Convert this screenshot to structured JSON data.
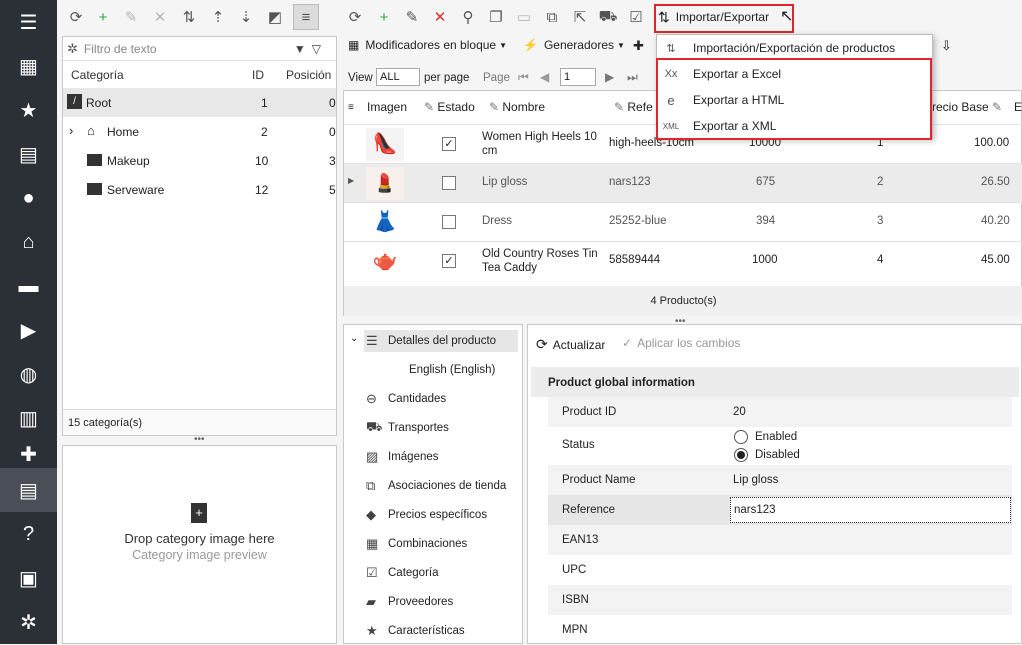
{
  "sidebar": {
    "icons": [
      "menu-icon",
      "store-icon",
      "star-icon",
      "inbox-icon",
      "user-icon",
      "basket-icon",
      "chat-icon",
      "truck-icon",
      "globe-icon",
      "chart-icon",
      "puzzle-icon",
      "box-icon",
      "help-icon",
      "lock-icon",
      "gear-icon"
    ]
  },
  "toolbar": {
    "import_export": "Importar/Exportar",
    "bulk_modifiers": "Modificadores en bloque",
    "generators": "Generadores"
  },
  "dropdown": {
    "items": [
      {
        "label": "Importación/Exportación de productos",
        "icon": "import-export-icon"
      },
      {
        "label": "Exportar a Excel",
        "icon": "excel-icon"
      },
      {
        "label": "Exportar a HTML",
        "icon": "html-icon"
      },
      {
        "label": "Exportar a XML",
        "icon": "xml-icon"
      }
    ]
  },
  "categories": {
    "filter_placeholder": "Filtro de texto",
    "headers": {
      "name": "Categoría",
      "id": "ID",
      "position": "Posición"
    },
    "rows": [
      {
        "name": "Root",
        "id": "1",
        "position": "0"
      },
      {
        "name": "Home",
        "id": "2",
        "position": "0"
      },
      {
        "name": "Makeup",
        "id": "10",
        "position": "3"
      },
      {
        "name": "Serveware",
        "id": "12",
        "position": "5"
      }
    ],
    "footer": "15 categoría(s)"
  },
  "image_drop": {
    "title": "Drop category image here",
    "subtitle": "Category image preview"
  },
  "paging": {
    "view_label": "View",
    "view_value": "ALL",
    "per_page": "per page",
    "page_label": "Page",
    "page_value": "1"
  },
  "grid": {
    "headers": {
      "image": "Imagen",
      "status": "Estado",
      "name": "Nombre",
      "reference": "Refe",
      "base_price": "recio Base"
    },
    "rows": [
      {
        "name": "Women High Heels 10 cm",
        "reference": "high-heels-10cm",
        "qty": "10000",
        "pos": "1",
        "price": "100.00",
        "checked": "✓"
      },
      {
        "name": "Lip gloss",
        "reference": "nars123",
        "qty": "675",
        "pos": "2",
        "price": "26.50",
        "checked": ""
      },
      {
        "name": "Dress",
        "reference": "25252-blue",
        "qty": "394",
        "pos": "3",
        "price": "40.20",
        "checked": ""
      },
      {
        "name": "Old Country Roses Tin Tea Caddy",
        "reference": "58589444",
        "qty": "1000",
        "pos": "4",
        "price": "45.00",
        "checked": "✓"
      }
    ],
    "footer": "4 Producto(s)"
  },
  "tree": {
    "items": [
      {
        "label": "Detalles del producto",
        "icon": "list-icon"
      },
      {
        "label": "English (English)",
        "icon": ""
      },
      {
        "label": "Cantidades",
        "icon": "quantities-icon"
      },
      {
        "label": "Transportes",
        "icon": "truck-icon"
      },
      {
        "label": "Imágenes",
        "icon": "image-icon"
      },
      {
        "label": "Asociaciones de tienda",
        "icon": "store-link-icon"
      },
      {
        "label": "Precios específicos",
        "icon": "tag-icon"
      },
      {
        "label": "Combinaciones",
        "icon": "grid-icon"
      },
      {
        "label": "Categoría",
        "icon": "category-icon"
      },
      {
        "label": "Proveedores",
        "icon": "supplier-icon"
      },
      {
        "label": "Características",
        "icon": "star-icon"
      }
    ]
  },
  "details": {
    "refresh": "Actualizar",
    "apply": "Aplicar los cambios",
    "section": "Product global information",
    "product_id_label": "Product ID",
    "product_id": "20",
    "status_label": "Status",
    "status_enabled": "Enabled",
    "status_disabled": "Disabled",
    "name_label": "Product Name",
    "name_value": "Lip gloss",
    "reference_label": "Reference",
    "reference_value": "nars123",
    "ean_label": "EAN13",
    "upc_label": "UPC",
    "isbn_label": "ISBN",
    "mpn_label": "MPN"
  }
}
